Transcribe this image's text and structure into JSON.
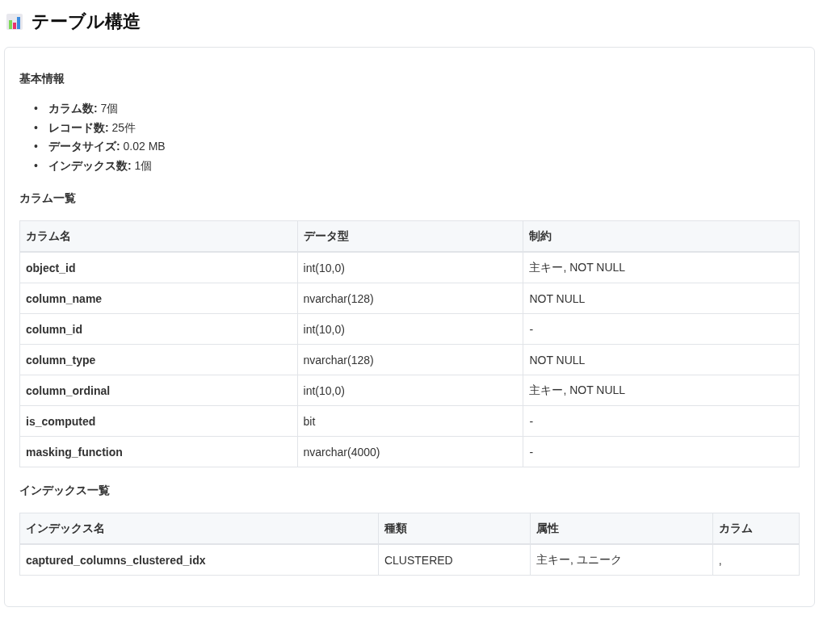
{
  "title": "テーブル構造",
  "basic_info": {
    "heading": "基本情報",
    "items": [
      {
        "marker": "•",
        "label": "カラム数:",
        "value": "7個"
      },
      {
        "marker": "•",
        "label": "レコード数:",
        "value": "25件"
      },
      {
        "marker": "•",
        "label": "データサイズ:",
        "value": "0.02 MB"
      },
      {
        "marker": "•",
        "label": "インデックス数:",
        "value": "1個"
      }
    ]
  },
  "columns_section": {
    "heading": "カラム一覧",
    "table": {
      "columns": [
        "カラム名",
        "データ型",
        "制約"
      ],
      "rows": [
        [
          "object_id",
          "int(10,0)",
          "主キー, NOT NULL"
        ],
        [
          "column_name",
          "nvarchar(128)",
          "NOT NULL"
        ],
        [
          "column_id",
          "int(10,0)",
          "-"
        ],
        [
          "column_type",
          "nvarchar(128)",
          "NOT NULL"
        ],
        [
          "column_ordinal",
          "int(10,0)",
          "主キー, NOT NULL"
        ],
        [
          "is_computed",
          "bit",
          "-"
        ],
        [
          "masking_function",
          "nvarchar(4000)",
          "-"
        ]
      ]
    }
  },
  "indexes_section": {
    "heading": "インデックス一覧",
    "table": {
      "columns": [
        "インデックス名",
        "種類",
        "属性",
        "カラム"
      ],
      "rows": [
        [
          "captured_columns_clustered_idx",
          "CLUSTERED",
          "主キー, ユニーク",
          ","
        ]
      ]
    }
  }
}
